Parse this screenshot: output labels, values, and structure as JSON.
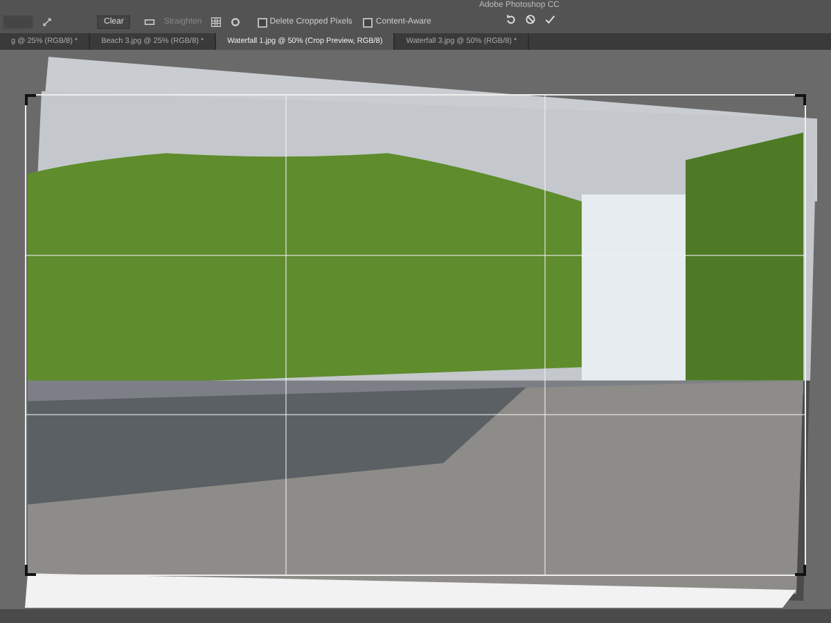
{
  "window": {
    "title": "Adobe Photoshop CC"
  },
  "options_bar": {
    "clear_button": "Clear",
    "straighten_label": "Straighten",
    "checkboxes": [
      {
        "label": "Delete Cropped Pixels",
        "checked": false
      },
      {
        "label": "Content-Aware",
        "checked": false
      }
    ]
  },
  "tabs": [
    {
      "label": "g @ 25% (RGB/8) *",
      "selected": false
    },
    {
      "label": "Beach 3.jpg @ 25% (RGB/8) *",
      "selected": false
    },
    {
      "label": "Waterfall 1.jpg @ 50% (Crop Preview, RGB/8)",
      "selected": true
    },
    {
      "label": "Waterfall 3.jpg @ 50% (RGB/8) *",
      "selected": false
    }
  ]
}
